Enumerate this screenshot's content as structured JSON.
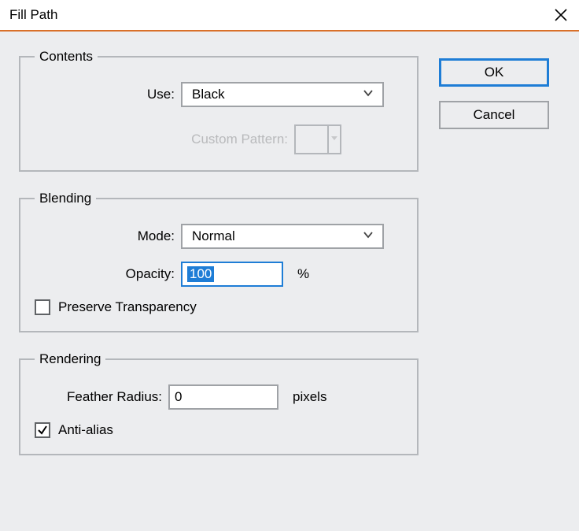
{
  "title": "Fill Path",
  "buttons": {
    "ok": "OK",
    "cancel": "Cancel"
  },
  "groups": {
    "contents": {
      "legend": "Contents",
      "use_label": "Use:",
      "use_value": "Black",
      "custom_pattern_label": "Custom Pattern:"
    },
    "blending": {
      "legend": "Blending",
      "mode_label": "Mode:",
      "mode_value": "Normal",
      "opacity_label": "Opacity:",
      "opacity_value": "100",
      "opacity_unit": "%",
      "preserve_label": "Preserve Transparency",
      "preserve_checked": false
    },
    "rendering": {
      "legend": "Rendering",
      "feather_label": "Feather Radius:",
      "feather_value": "0",
      "feather_unit": "pixels",
      "antialias_label": "Anti-alias",
      "antialias_checked": true
    }
  }
}
